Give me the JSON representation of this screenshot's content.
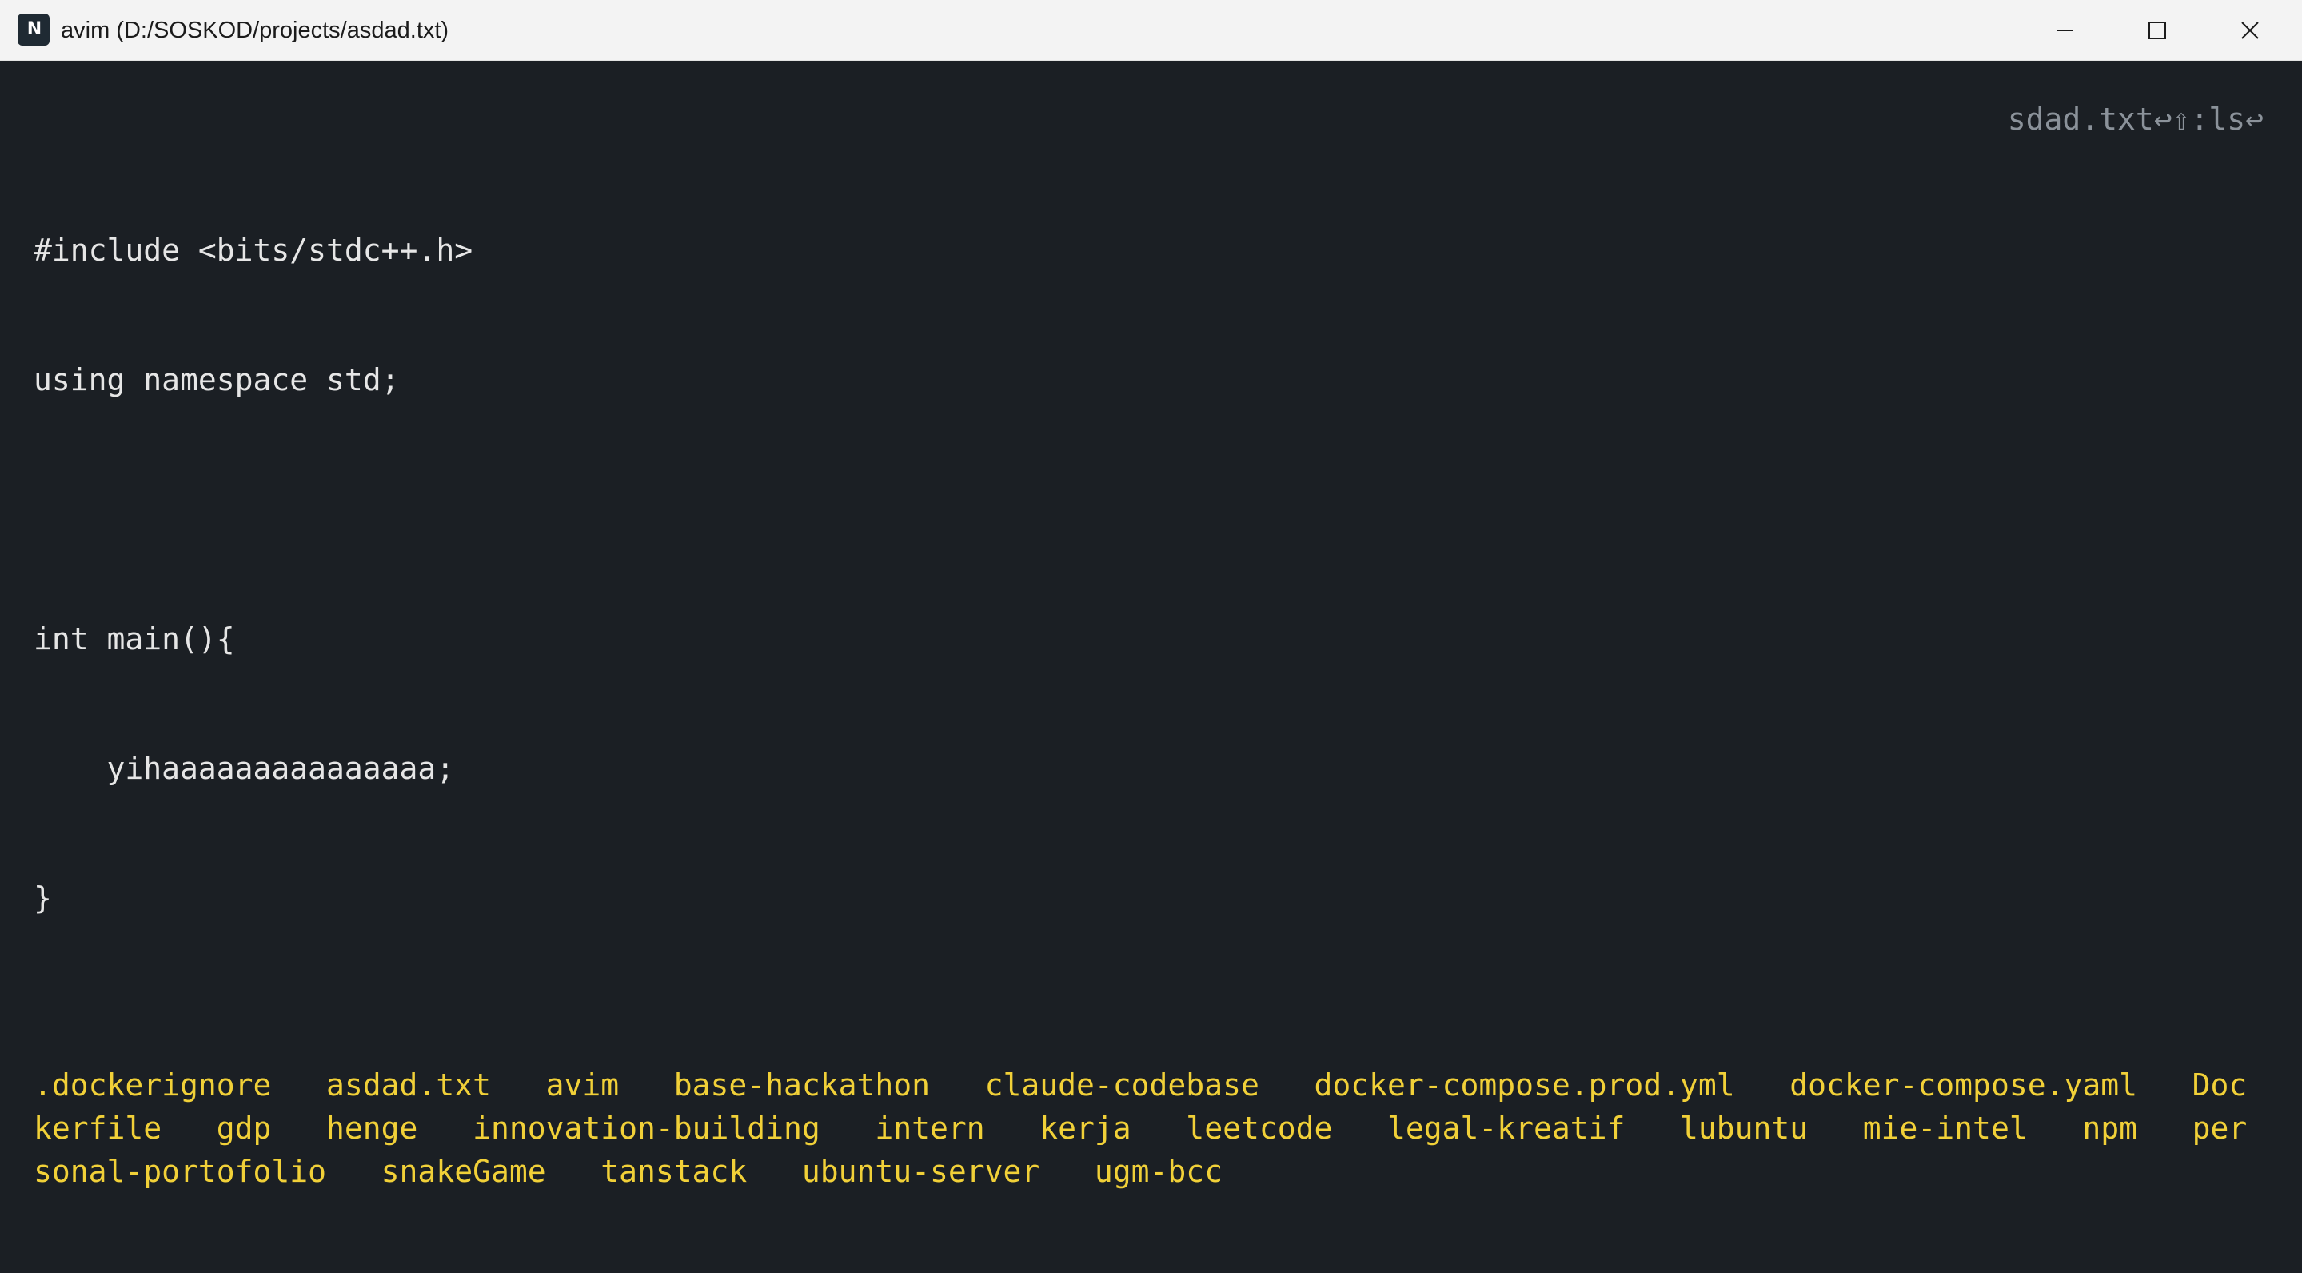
{
  "window": {
    "title": "avim (D:/SOSKOD/projects/asdad.txt)",
    "icon": "neovim-icon",
    "controls": [
      "minimize-icon",
      "maximize-icon",
      "close-icon"
    ]
  },
  "editor": {
    "showcmd": "sdad.txt↩⇧:ls↩",
    "lines": [
      "#include <bits/stdc++.h>",
      "using namespace std;",
      "",
      "int main(){",
      "    yihaaaaaaaaaaaaaaa;",
      "}"
    ]
  },
  "ls_output": {
    "lines": [
      ".dockerignore   asdad.txt   avim   base-hackathon   claude-codebase   docker-compose.prod.yml   docker-compose.yaml   Doc",
      "kerfile   gdp   henge   innovation-building   intern   kerja   leetcode   legal-kreatif   lubuntu   mie-intel   npm   per",
      "sonal-portofolio   snakeGame   tanstack   ubuntu-server   ugm-bcc"
    ]
  },
  "colors": {
    "background": "#1b1f24",
    "text": "#e6e6e6",
    "directory_listing": "#f1d038",
    "showcmd": "#8b929a",
    "titlebar": "#f3f3f3"
  }
}
